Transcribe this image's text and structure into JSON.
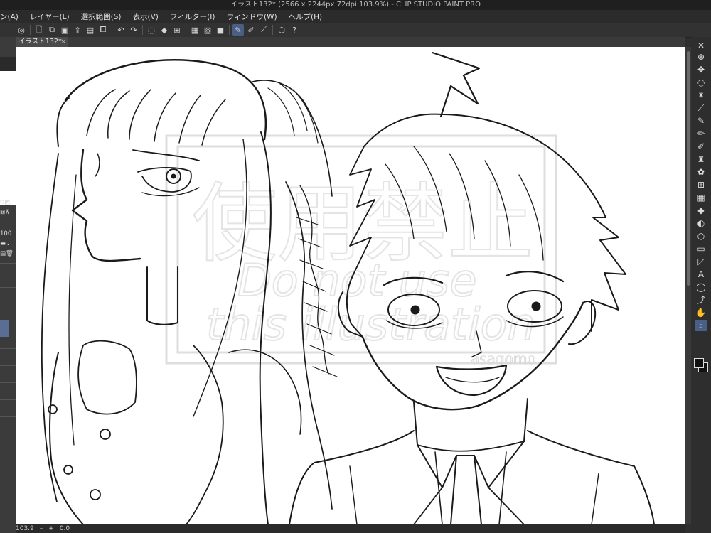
{
  "window": {
    "title": "イラスト132* (2566 x 2244px 72dpi 103.9%)  - CLIP STUDIO PAINT PRO"
  },
  "menu": [
    {
      "label": "ン(A)"
    },
    {
      "label": "レイヤー(L)"
    },
    {
      "label": "選択範囲(S)"
    },
    {
      "label": "表示(V)"
    },
    {
      "label": "フィルター(I)"
    },
    {
      "label": "ウィンドウ(W)"
    },
    {
      "label": "ヘルプ(H)"
    }
  ],
  "canvas_tab": {
    "label": "イラスト132*",
    "close": "×"
  },
  "left_panel": {
    "opacity_value": "100"
  },
  "status": {
    "zoom": "103.9",
    "angle": "0.0"
  },
  "watermark": {
    "kanji": "使用禁止",
    "line1": "Do not use",
    "line2": "this illustration",
    "signature": "asagomo"
  },
  "toolbar_icons": [
    "app-icon",
    "new-file-icon",
    "open-file-icon",
    "save-icon",
    "export-icon",
    "print-icon",
    "copy-icon",
    "undo-icon",
    "redo-icon",
    "deselect-icon",
    "fill-icon",
    "transform-icon",
    "grid-icon",
    "ruler-icon",
    "snap-icon",
    "pen-tool-icon",
    "brush-tool-icon",
    "line-tool-icon",
    "cube-icon",
    "help-icon"
  ],
  "tools": [
    "zoom-tool-icon",
    "move-tool-icon",
    "lasso-tool-icon",
    "magic-wand-icon",
    "eyedropper-icon",
    "pen-icon",
    "pencil-icon",
    "brush-icon",
    "airbrush-icon",
    "decoration-icon",
    "eraser-icon",
    "blend-icon",
    "fill-bucket-icon",
    "gradient-icon",
    "figure-icon",
    "frame-icon",
    "ruler-tool-icon",
    "text-tool-icon",
    "balloon-icon",
    "correct-line-icon",
    "hand-tool-icon",
    "search-tool-icon"
  ]
}
